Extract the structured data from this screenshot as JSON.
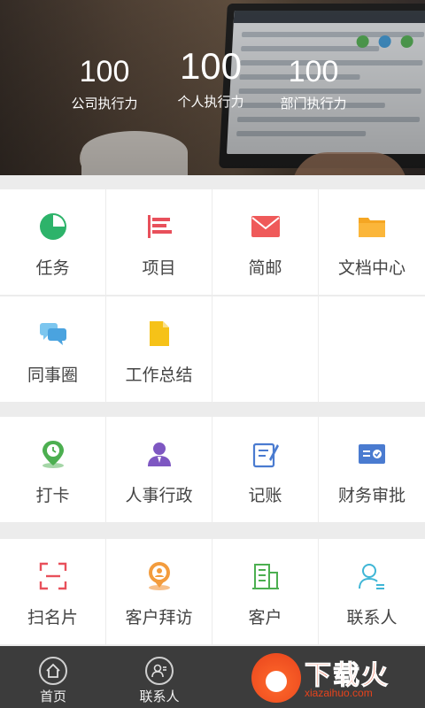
{
  "header": {
    "stats": [
      {
        "value": "100",
        "label": "公司执行力"
      },
      {
        "value": "100",
        "label": "个人执行力"
      },
      {
        "value": "100",
        "label": "部门执行力"
      }
    ]
  },
  "sections": [
    {
      "items": [
        {
          "label": "任务",
          "icon": "pie-chart-icon",
          "color": "#2db36a"
        },
        {
          "label": "项目",
          "icon": "bar-list-icon",
          "color": "#e8505b"
        },
        {
          "label": "简邮",
          "icon": "envelope-icon",
          "color": "#ef5a5a"
        },
        {
          "label": "文档中心",
          "icon": "folder-icon",
          "color": "#f5a623"
        },
        {
          "label": "同事圈",
          "icon": "chat-bubbles-icon",
          "color": "#4aa3df"
        },
        {
          "label": "工作总结",
          "icon": "document-icon",
          "color": "#f6c218"
        }
      ]
    },
    {
      "items": [
        {
          "label": "打卡",
          "icon": "location-clock-icon",
          "color": "#4caf50"
        },
        {
          "label": "人事行政",
          "icon": "person-icon",
          "color": "#7e57c2"
        },
        {
          "label": "记账",
          "icon": "notepad-pen-icon",
          "color": "#4a7bd0"
        },
        {
          "label": "财务审批",
          "icon": "approval-card-icon",
          "color": "#4a7bd0"
        }
      ]
    },
    {
      "items": [
        {
          "label": "扫名片",
          "icon": "scan-frame-icon",
          "color": "#e8505b"
        },
        {
          "label": "客户拜访",
          "icon": "visit-pin-icon",
          "color": "#f39c3d"
        },
        {
          "label": "客户",
          "icon": "building-icon",
          "color": "#4caf50"
        },
        {
          "label": "联系人",
          "icon": "contact-person-icon",
          "color": "#3fb6d6"
        }
      ]
    }
  ],
  "nav": {
    "items": [
      {
        "label": "首页",
        "icon": "home-icon"
      },
      {
        "label": "联系人",
        "icon": "contacts-icon"
      }
    ]
  },
  "watermark": {
    "big": "下载火",
    "small": "xiazaihuo.com"
  }
}
